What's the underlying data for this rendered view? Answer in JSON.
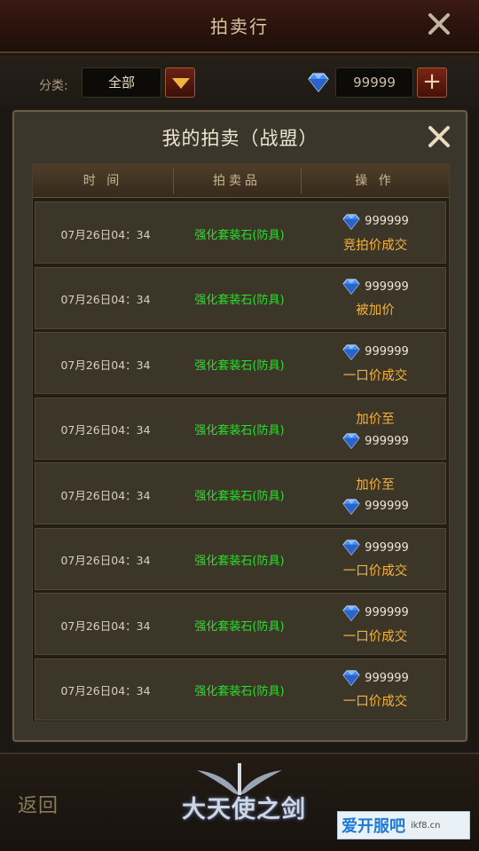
{
  "header": {
    "title": "拍卖行",
    "close_icon": "close-icon"
  },
  "filter": {
    "label": "分类:",
    "value": "全部",
    "currency_icon": "diamond-icon",
    "currency_amount": "99999",
    "add_icon": "plus-icon"
  },
  "modal": {
    "title": "我的拍卖（战盟）",
    "close_icon": "close-icon",
    "columns": [
      "时 间",
      "拍卖品",
      "操 作"
    ],
    "rows": [
      {
        "time": "07月26日04：34",
        "item": "强化套装石(防具)",
        "price": "999999",
        "status": "竞拍价成交",
        "order": "price-first"
      },
      {
        "time": "07月26日04：34",
        "item": "强化套装石(防具)",
        "price": "999999",
        "status": "被加价",
        "order": "price-first"
      },
      {
        "time": "07月26日04：34",
        "item": "强化套装石(防具)",
        "price": "999999",
        "status": "一口价成交",
        "order": "price-first"
      },
      {
        "time": "07月26日04：34",
        "item": "强化套装石(防具)",
        "price": "999999",
        "status": "加价至",
        "order": "status-first"
      },
      {
        "time": "07月26日04：34",
        "item": "强化套装石(防具)",
        "price": "999999",
        "status": "加价至",
        "order": "status-first"
      },
      {
        "time": "07月26日04：34",
        "item": "强化套装石(防具)",
        "price": "999999",
        "status": "一口价成交",
        "order": "price-first"
      },
      {
        "time": "07月26日04：34",
        "item": "强化套装石(防具)",
        "price": "999999",
        "status": "一口价成交",
        "order": "price-first"
      },
      {
        "time": "07月26日04：34",
        "item": "强化套装石(防具)",
        "price": "999999",
        "status": "一口价成交",
        "order": "price-first"
      }
    ]
  },
  "footer": {
    "back_label": "返回",
    "logo_text": "大天使之剑",
    "watermark_text": "爱开服吧",
    "watermark_url": "ikf8.cn"
  },
  "colors": {
    "item_green": "#27e02a",
    "status_orange": "#f5b13a",
    "diamond_blue": "#4a8ef0"
  }
}
